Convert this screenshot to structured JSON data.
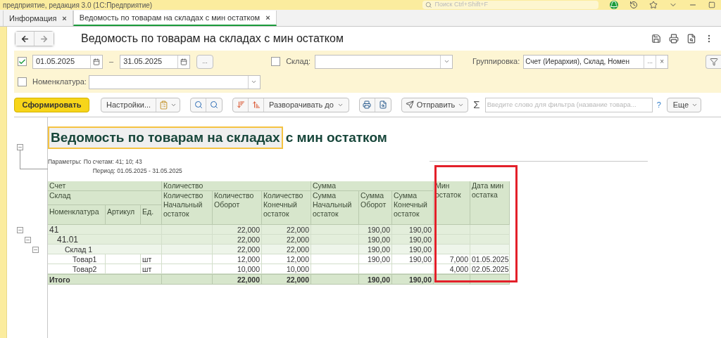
{
  "app_title": "предприятие, редакция 3.0  (1С:Предприятие)",
  "global_search": {
    "placeholder": "Поиск Ctrl+Shift+F"
  },
  "tabs": [
    {
      "label": "Информация",
      "close": "×",
      "selected": false
    },
    {
      "label": "Ведомость по товарам на складах с мин остатком",
      "close": "×",
      "selected": true
    }
  ],
  "form_title": "Ведомость по товарам на складах с мин остатком",
  "filters": {
    "period_enabled": true,
    "date_from": "01.05.2025",
    "dash": "–",
    "date_to": "31.05.2025",
    "more": "...",
    "warehouse": {
      "checked": false,
      "label": "Склад:"
    },
    "grouping": {
      "label": "Группировка:",
      "value": "Счет (Иерархия), Склад, Номен",
      "more": "...",
      "clear": "×"
    },
    "nomenclature": {
      "checked": false,
      "label": "Номенклатура:"
    }
  },
  "toolbar": {
    "generate": "Сформировать",
    "settings": "Настройки...",
    "expand_to": "Разворачивать до",
    "send": "Отправить",
    "sigma": "Σ",
    "filter_placeholder": "Введите слово для фильтра (название товара...",
    "help": "?",
    "more": "Еще"
  },
  "report": {
    "title_highlighted": "Ведомость по товарам на складах",
    "title_rest": "с мин остатком",
    "params_label": "Параметры:",
    "params": [
      "По счетам: 41; 10; 43",
      "Период: 01.05.2025 - 31.05.2025"
    ],
    "header": {
      "account": "Счет",
      "warehouse": "Склад",
      "nomenclature": "Номенклатура",
      "article": "Артикул",
      "unit": "Ед.",
      "quantity": "Количество",
      "qty_start": "Количество Начальный остаток",
      "qty_turnover": "Количество Оборот",
      "qty_end": "Количество Конечный остаток",
      "sum": "Сумма",
      "sum_start": "Сумма Начальный остаток",
      "sum_turnover": "Сумма Оборот",
      "sum_end": "Сумма Конечный остаток",
      "min_balance": "Мин остаток",
      "min_date": "Дата мин остатка"
    },
    "rows": [
      {
        "label": "41",
        "expanded": true,
        "qty_turnover": "22,000",
        "qty_end": "22,000",
        "sum_turnover": "190,00",
        "sum_end": "190,00",
        "children": [
          {
            "label": "41.01",
            "expanded": true,
            "qty_turnover": "22,000",
            "qty_end": "22,000",
            "sum_turnover": "190,00",
            "sum_end": "190,00",
            "children": [
              {
                "label": "Склад 1",
                "expanded": true,
                "qty_turnover": "22,000",
                "qty_end": "22,000",
                "sum_turnover": "190,00",
                "sum_end": "190,00",
                "children": [
                  {
                    "label": "Товар1",
                    "unit": "шт",
                    "qty_turnover": "12,000",
                    "qty_end": "12,000",
                    "sum_turnover": "190,00",
                    "sum_end": "190,00",
                    "min_balance": "7,000",
                    "min_date": "01.05.2025"
                  },
                  {
                    "label": "Товар2",
                    "unit": "шт",
                    "qty_turnover": "10,000",
                    "qty_end": "10,000",
                    "min_balance": "4,000",
                    "min_date": "02.05.2025"
                  }
                ]
              }
            ]
          }
        ]
      }
    ],
    "total": {
      "label": "Итого",
      "qty_turnover": "22,000",
      "qty_end": "22,000",
      "sum_turnover": "190,00",
      "sum_end": "190,00"
    }
  }
}
